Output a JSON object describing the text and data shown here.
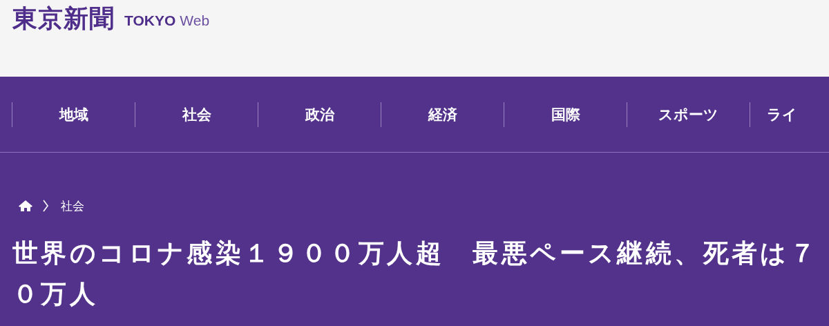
{
  "header": {
    "logo": "東京新聞",
    "brand": "TOKYO",
    "brand_suffix": "Web"
  },
  "nav": {
    "items": [
      {
        "label": "地域"
      },
      {
        "label": "社会"
      },
      {
        "label": "政治"
      },
      {
        "label": "経済"
      },
      {
        "label": "国際"
      },
      {
        "label": "スポーツ"
      },
      {
        "label": "ライ"
      }
    ]
  },
  "breadcrumb": {
    "items": [
      "社会"
    ]
  },
  "article": {
    "title": "世界のコロナ感染１９００万人超　最悪ペース継続、死者は７０万人"
  }
}
